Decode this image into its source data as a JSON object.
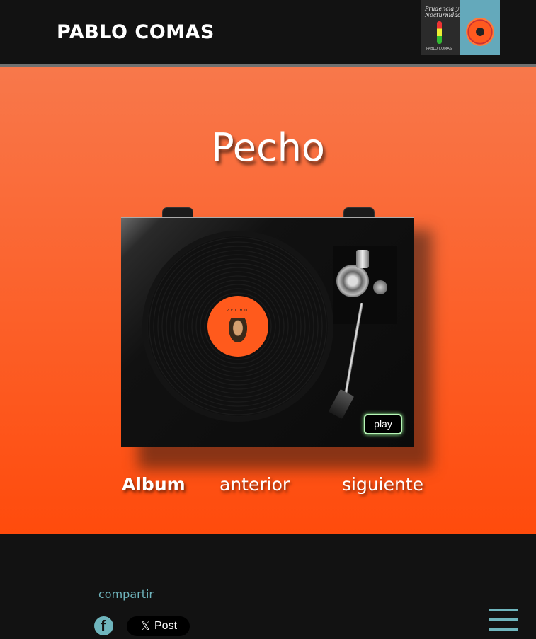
{
  "header": {
    "brand": "PABLO COMAS",
    "cover_left_title": "Prudencia y Nocturnidad",
    "cover_left_subtitle": "PABLO COMAS",
    "cover_right_text": ""
  },
  "track": {
    "title": "Pecho",
    "label_text": "PECHO"
  },
  "player": {
    "play_label": "play"
  },
  "nav": {
    "album": "Album",
    "previous": "anterior",
    "next": "siguiente"
  },
  "footer": {
    "share_label": "compartir",
    "x_logo": "𝕏",
    "x_label": "Post"
  },
  "colors": {
    "accent": "#6fb5bd",
    "orange_top": "#f8784b",
    "orange_bottom": "#ff4b0c",
    "background": "#121212"
  }
}
